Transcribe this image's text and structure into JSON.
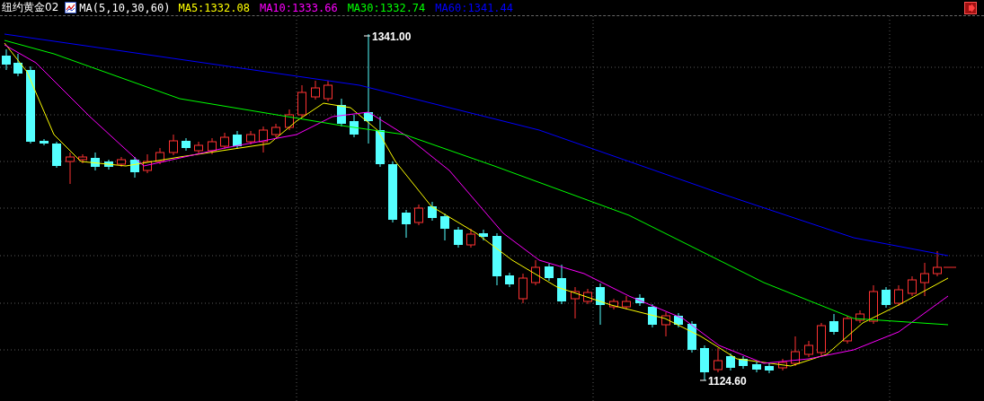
{
  "header": {
    "title": "纽约黄金02",
    "indicator": "MA(5,10,30,60)",
    "legend": [
      {
        "label": "MA5:",
        "value": "1332.08",
        "color": "#ffff00"
      },
      {
        "label": "MA10:",
        "value": "1333.66",
        "color": "#ff00ff"
      },
      {
        "label": "MA30:",
        "value": "1332.74",
        "color": "#00ff00"
      },
      {
        "label": "MA60:",
        "value": "1341.44",
        "color": "#0000ff"
      }
    ]
  },
  "chart": {
    "high_label": "1341.00",
    "low_label": "1124.60"
  }
}
